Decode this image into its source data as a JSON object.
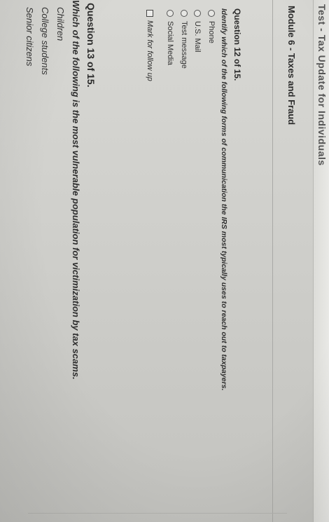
{
  "header": {
    "test_title": "Test - Tax Update for Individuals"
  },
  "module": {
    "title": "Module 6 - Taxes and Fraud"
  },
  "question12": {
    "heading": "Question 12 of 15.",
    "prompt": "Identify which of the following forms of communication the IRS most typically uses to reach out to taxpayers.",
    "options": [
      "Phone",
      "U.S. Mail",
      "Test message",
      "Social Media"
    ],
    "follow_up_label": "Mark for follow up"
  },
  "question13": {
    "heading": "Question 13 of 15.",
    "prompt": "Which of the following is the most vulnerable population for victimization by tax scams.",
    "options": [
      "Children",
      "College students",
      "Senior citizens"
    ]
  }
}
